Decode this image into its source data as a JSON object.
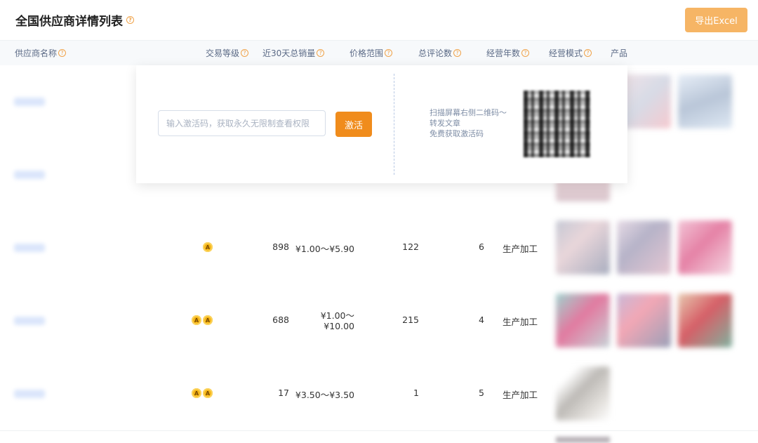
{
  "page": {
    "title": "全国供应商详情列表"
  },
  "toolbar": {
    "export_label": "导出Excel"
  },
  "columns": {
    "supplier": "供应商名称",
    "level": "交易等级",
    "sales30": "近30天总销量",
    "price": "价格范围",
    "reviews": "总评论数",
    "years": "经营年数",
    "mode": "经营模式",
    "product": "产品"
  },
  "rows": [
    {
      "badges": 0,
      "sales": "",
      "price1": "",
      "price2": "",
      "reviews": "",
      "years": "",
      "mode": ""
    },
    {
      "badges": 0,
      "sales": "",
      "price1": "",
      "price2": "",
      "reviews": "",
      "years": "",
      "mode": ""
    },
    {
      "badges": 1,
      "sales": "898",
      "price1": "¥1.00～¥5.90",
      "price2": "",
      "reviews": "122",
      "years": "6",
      "mode": "生产加工"
    },
    {
      "badges": 2,
      "sales": "688",
      "price1": "¥1.00～",
      "price2": "¥10.00",
      "reviews": "215",
      "years": "4",
      "mode": "生产加工"
    },
    {
      "badges": 2,
      "sales": "17",
      "price1": "¥3.50～¥3.50",
      "price2": "",
      "reviews": "1",
      "years": "5",
      "mode": "生产加工"
    }
  ],
  "overlay": {
    "placeholder": "输入激活码，获取永久无限制查看权限",
    "activate_label": "激活",
    "hint_line1": "扫描屏幕右侧二维码～",
    "hint_line2": "转发文章",
    "hint_line3": "免费获取激活码"
  },
  "icons": {
    "help": "question-circle-icon",
    "badge": "crown-badge-icon",
    "qr": "qr-code-icon"
  },
  "colors": {
    "accent": "#f08c1c",
    "export": "#f6b565",
    "badge": "#f6b618",
    "link": "#dbe6fb"
  }
}
